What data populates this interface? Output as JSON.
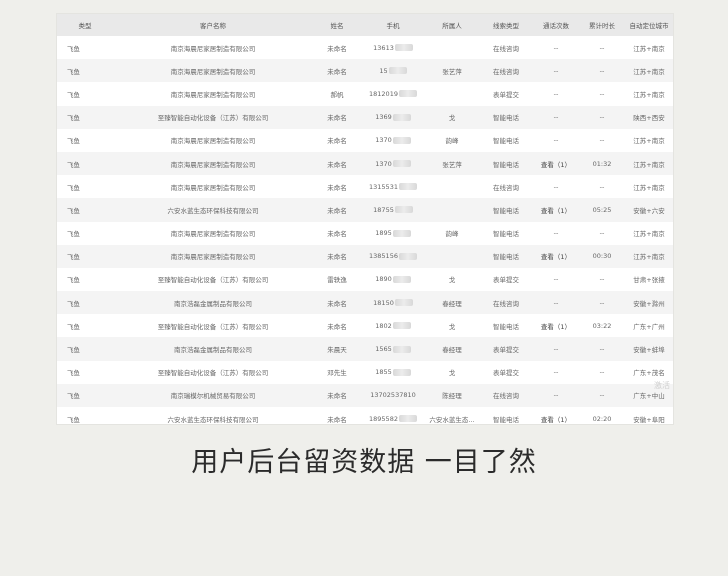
{
  "headers": [
    "类型",
    "客户名称",
    "姓名",
    "手机",
    "所属人",
    "线索类型",
    "通话次数",
    "累计时长",
    "自动定位城市"
  ],
  "rows": [
    {
      "type": "飞鱼",
      "company": "南京海晨尼家居制造有限公司",
      "name": "未命名",
      "phone": "13613",
      "owner": "",
      "lead": "在线咨询",
      "calls": "--",
      "duration": "--",
      "city": "江苏+南京"
    },
    {
      "type": "飞鱼",
      "company": "南京海晨尼家居制造有限公司",
      "name": "未命名",
      "phone": "15",
      "owner": "张艺萍",
      "lead": "在线咨询",
      "calls": "--",
      "duration": "--",
      "city": "江苏+南京"
    },
    {
      "type": "飞鱼",
      "company": "南京海晨尼家居制造有限公司",
      "name": "郝帆",
      "phone": "1812019",
      "owner": "",
      "lead": "表单提交",
      "calls": "--",
      "duration": "--",
      "city": "江苏+南京"
    },
    {
      "type": "飞鱼",
      "company": "至臻智能自动化设备（江苏）有限公司",
      "name": "未命名",
      "phone": "1369",
      "owner": "戈",
      "lead": "智能电话",
      "calls": "--",
      "duration": "--",
      "city": "陕西+西安"
    },
    {
      "type": "飞鱼",
      "company": "南京海晨尼家居制造有限公司",
      "name": "未命名",
      "phone": "1370",
      "owner": "韵峰",
      "lead": "智能电话",
      "calls": "--",
      "duration": "--",
      "city": "江苏+南京"
    },
    {
      "type": "飞鱼",
      "company": "南京海晨尼家居制造有限公司",
      "name": "未命名",
      "phone": "1370",
      "owner": "张艺萍",
      "lead": "智能电话",
      "calls": "查看（1）",
      "duration": "01:32",
      "city": "江苏+南京"
    },
    {
      "type": "飞鱼",
      "company": "南京海晨尼家居制造有限公司",
      "name": "未命名",
      "phone": "1315531",
      "owner": "",
      "lead": "在线咨询",
      "calls": "--",
      "duration": "--",
      "city": "江苏+南京"
    },
    {
      "type": "飞鱼",
      "company": "六安水蓝生态环保科技有限公司",
      "name": "未命名",
      "phone": "18755",
      "owner": "",
      "lead": "智能电话",
      "calls": "查看（1）",
      "duration": "05:25",
      "city": "安徽+六安"
    },
    {
      "type": "飞鱼",
      "company": "南京海晨尼家居制造有限公司",
      "name": "未命名",
      "phone": "1895",
      "owner": "韵峰",
      "lead": "智能电话",
      "calls": "--",
      "duration": "--",
      "city": "江苏+南京"
    },
    {
      "type": "飞鱼",
      "company": "南京海晨尼家居制造有限公司",
      "name": "未命名",
      "phone": "1385156",
      "owner": "",
      "lead": "智能电话",
      "calls": "查看（1）",
      "duration": "00:30",
      "city": "江苏+南京"
    },
    {
      "type": "飞鱼",
      "company": "至臻智能自动化设备（江苏）有限公司",
      "name": "雷轶逸",
      "phone": "1890",
      "owner": "戈",
      "lead": "表单提交",
      "calls": "--",
      "duration": "--",
      "city": "甘肃+张掖"
    },
    {
      "type": "飞鱼",
      "company": "南京浩磊金属制品有限公司",
      "name": "未命名",
      "phone": "18150",
      "owner": "春经理",
      "lead": "在线咨询",
      "calls": "--",
      "duration": "--",
      "city": "安徽+滁州"
    },
    {
      "type": "飞鱼",
      "company": "至臻智能自动化设备（江苏）有限公司",
      "name": "未命名",
      "phone": "1802",
      "owner": "戈",
      "lead": "智能电话",
      "calls": "查看（1）",
      "duration": "03:22",
      "city": "广东+广州"
    },
    {
      "type": "飞鱼",
      "company": "南京浩磊金属制品有限公司",
      "name": "朱晨天",
      "phone": "1565",
      "owner": "春经理",
      "lead": "表单提交",
      "calls": "--",
      "duration": "--",
      "city": "安徽+蚌埠"
    },
    {
      "type": "飞鱼",
      "company": "至臻智能自动化设备（江苏）有限公司",
      "name": "邓先生",
      "phone": "1855",
      "owner": "戈",
      "lead": "表单提交",
      "calls": "--",
      "duration": "--",
      "city": "广东+茂名"
    },
    {
      "type": "飞鱼",
      "company": "南京瑞模尔机械贸易有限公司",
      "name": "未命名",
      "phone": "13702537810",
      "owner": "陈经理",
      "lead": "在线咨询",
      "calls": "--",
      "duration": "--",
      "city": "广东+中山"
    },
    {
      "type": "飞鱼",
      "company": "六安水蓝生态环保科技有限公司",
      "name": "未命名",
      "phone": "1895582",
      "owner": "六安水蓝生态...",
      "lead": "智能电话",
      "calls": "查看（1）",
      "duration": "02:20",
      "city": "安徽+阜阳"
    }
  ],
  "watermark": "激活",
  "caption": "用户后台留资数据 一目了然"
}
